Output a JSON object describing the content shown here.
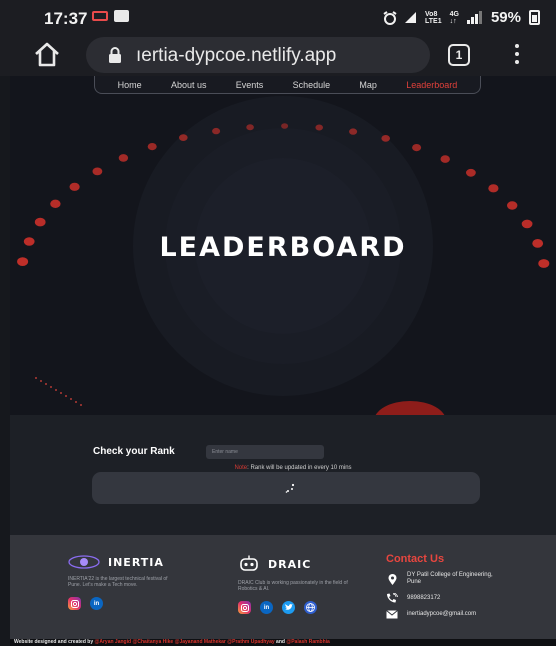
{
  "statusbar": {
    "time": "17:37",
    "network_top": "Vo8",
    "network_bottom": "LTE1",
    "net_type_top": "4G",
    "net_type_bottom": "↓↑",
    "battery": "59%"
  },
  "browser": {
    "url": "ıertia-dypcoe.netlify.app",
    "tab_count": "1"
  },
  "nav": {
    "items": [
      {
        "label": "Home"
      },
      {
        "label": "About us"
      },
      {
        "label": "Events"
      },
      {
        "label": "Schedule"
      },
      {
        "label": "Map"
      },
      {
        "label": "Leaderboard"
      }
    ],
    "active_color": "#e0403a"
  },
  "hero": {
    "title": "LEADERBOARD",
    "accent_color": "#c8302a"
  },
  "rank": {
    "label": "Check your Rank",
    "placeholder": "Enter name",
    "note_label": "Note",
    "note_text": ": Rank will be updated in every 10 mins"
  },
  "footer": {
    "inertia": {
      "name": "INERTIA",
      "description": "INERTIA'22 is the largest technical festival of Pune. Let's make a Tech move.",
      "socials": [
        "instagram-icon",
        "linkedin-icon"
      ]
    },
    "draic": {
      "name": "DRAIC",
      "description": "DRAIC Club is working passionately in the field of Robotics & AI.",
      "socials": [
        "instagram-icon",
        "linkedin-icon",
        "twitter-icon",
        "globe-icon"
      ]
    },
    "contact": {
      "title": "Contact Us",
      "address": "DY Patil College of Engineering, Pune",
      "phone": "9898823172",
      "email": "inertiadypcoe@gmail.com"
    }
  },
  "credits": {
    "prefix": "Website designed and created by",
    "names": [
      "@Aryan Jangid",
      "@Chaitanya Hike",
      "@Jayanand Mathekar",
      "@Prathm Upadhyay"
    ],
    "and": "and",
    "last": "@Palash Rambhia"
  }
}
